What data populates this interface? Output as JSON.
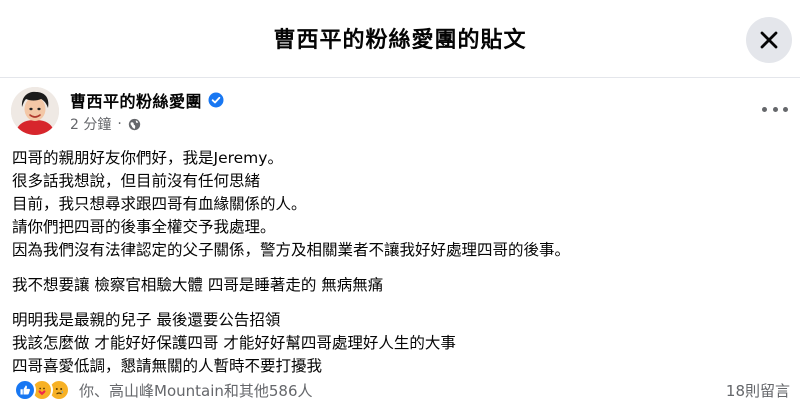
{
  "dialog": {
    "title": "曹西平的粉絲愛團的貼文"
  },
  "post": {
    "page_name": "曹西平的粉絲愛團",
    "verified_icon": "verified-badge-icon",
    "time": "2 分鐘",
    "separator": "·",
    "audience_icon": "globe-icon",
    "paragraphs": [
      [
        "四哥的親朋好友你們好，我是Jeremy。",
        "很多話我想說，但目前沒有任何思緒",
        "目前，我只想尋求跟四哥有血緣關係的人。",
        "請你們把四哥的後事全權交予我處理。",
        "因為我們沒有法律認定的父子關係，警方及相關業者不讓我好好處理四哥的後事。"
      ],
      [
        "我不想要讓 檢察官相驗大體 四哥是睡著走的 無病無痛"
      ],
      [
        "明明我是最親的兒子 最後還要公告招領",
        "我該怎麼做 才能好好保護四哥 才能好好幫四哥處理好人生的大事",
        "四哥喜愛低調，懇請無關的人暫時不要打擾我"
      ]
    ],
    "reactions": {
      "icons": [
        "like-icon",
        "care-icon",
        "sad-icon"
      ],
      "text": "你、高山峰Mountain和其他586人"
    },
    "comments": "18則留言"
  },
  "colors": {
    "accent": "#1877f2",
    "secondary_text": "#65676b",
    "close_bg": "#e4e6eb"
  }
}
